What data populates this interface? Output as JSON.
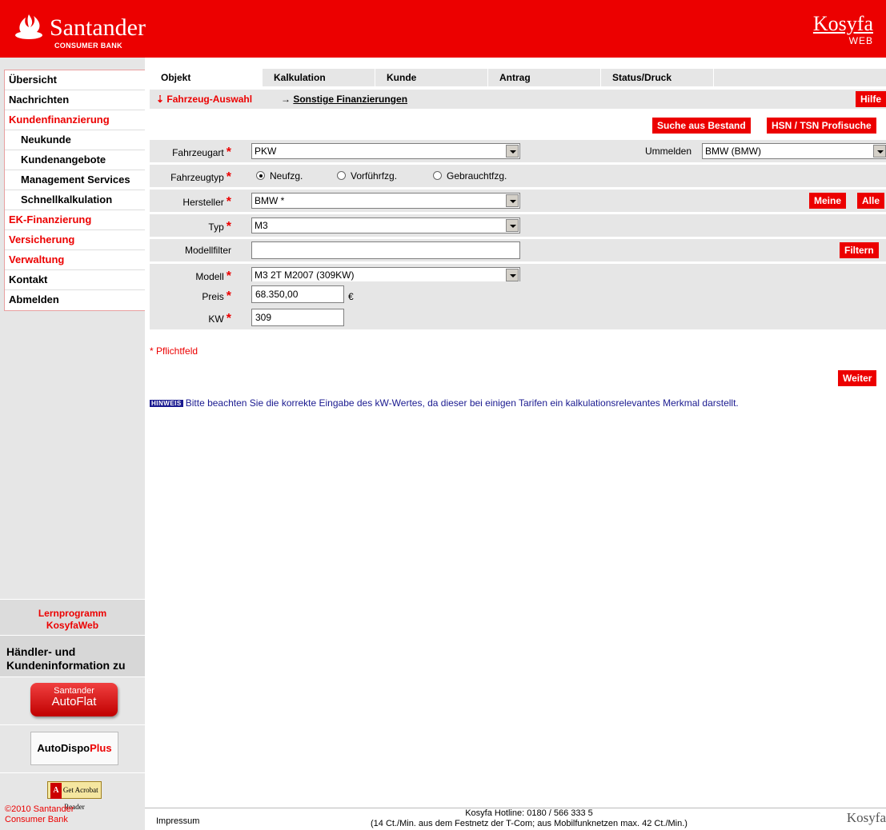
{
  "header": {
    "brand": "Santander",
    "brand_sub": "CONSUMER BANK",
    "app_name": "Kosyfa",
    "app_sub": "WEB"
  },
  "sidebar": {
    "items": [
      {
        "label": "Übersicht"
      },
      {
        "label": "Nachrichten"
      },
      {
        "label": "Kundenfinanzierung"
      },
      {
        "label": "Neukunde"
      },
      {
        "label": "Kundenangebote"
      },
      {
        "label": "Management Services"
      },
      {
        "label": "Schnellkalkulation"
      },
      {
        "label": "EK-Finanzierung"
      },
      {
        "label": "Versicherung"
      },
      {
        "label": "Verwaltung"
      },
      {
        "label": "Kontakt"
      },
      {
        "label": "Abmelden"
      }
    ],
    "lern_line1": "Lernprogramm",
    "lern_line2": "KosyfaWeb",
    "info_line1": "Händler- und",
    "info_line2": "Kundeninformation zu",
    "autoflat_line1": "Santander",
    "autoflat_line2": "AutoFlat",
    "dispo_a": "AutoDispo",
    "dispo_b": "Plus",
    "acrobat_get": "Get",
    "acrobat_text": "Acrobat Reader",
    "copyright_line1": "©2010 Santander",
    "copyright_line2": "Consumer Bank"
  },
  "tabs": [
    {
      "label": "Objekt"
    },
    {
      "label": "Kalkulation"
    },
    {
      "label": "Kunde"
    },
    {
      "label": "Antrag"
    },
    {
      "label": "Status/Druck"
    }
  ],
  "subbar": {
    "active": "⇣ Fahrzeug-Auswahl",
    "other_arrow": "→",
    "other": "Sonstige Finanzierungen",
    "help": "Hilfe"
  },
  "buttons": {
    "suche": "Suche aus Bestand",
    "hsn": "HSN / TSN Profisuche",
    "meine": "Meine",
    "alle": "Alle",
    "filtern": "Filtern",
    "weiter": "Weiter"
  },
  "form": {
    "fahrzeugart_label": "Fahrzeugart",
    "fahrzeugart_value": "PKW",
    "ummelden_label": "Ummelden",
    "ummelden_value": "BMW (BMW)",
    "fahrzeugtyp_label": "Fahrzeugtyp",
    "radio_neu": "Neufzg.",
    "radio_vorf": "Vorführfzg.",
    "radio_gebr": "Gebrauchtfzg.",
    "hersteller_label": "Hersteller",
    "hersteller_value": "BMW *",
    "typ_label": "Typ",
    "typ_value": "M3",
    "modellfilter_label": "Modellfilter",
    "modellfilter_value": "",
    "modell_label": "Modell",
    "modell_value": "M3 2T M2007 (309KW)",
    "preis_label": "Preis",
    "preis_value": "68.350,00",
    "currency": "€",
    "kw_label": "KW",
    "kw_value": "309",
    "required_mark": "*"
  },
  "pflichtfeld": "* Pflichtfeld",
  "hinweis_tag": "HINWEIS",
  "hinweis_text": "Bitte beachten Sie die korrekte Eingabe des kW-Wertes, da dieser bei einigen Tarifen ein kalkulationsrelevantes Merkmal darstellt.",
  "footer": {
    "impressum": "Impressum",
    "hotline1": "Kosyfa Hotline: 0180 / 566 333 5",
    "hotline2": "(14 Ct./Min. aus dem Festnetz der T-Com; aus Mobilfunknetzen max. 42 Ct./Min.)",
    "brand": "Kosyfa"
  },
  "colors": {
    "brand_red": "#ec0000",
    "hint_blue": "#1a1a90",
    "panel_grey": "#e6e6e6"
  }
}
